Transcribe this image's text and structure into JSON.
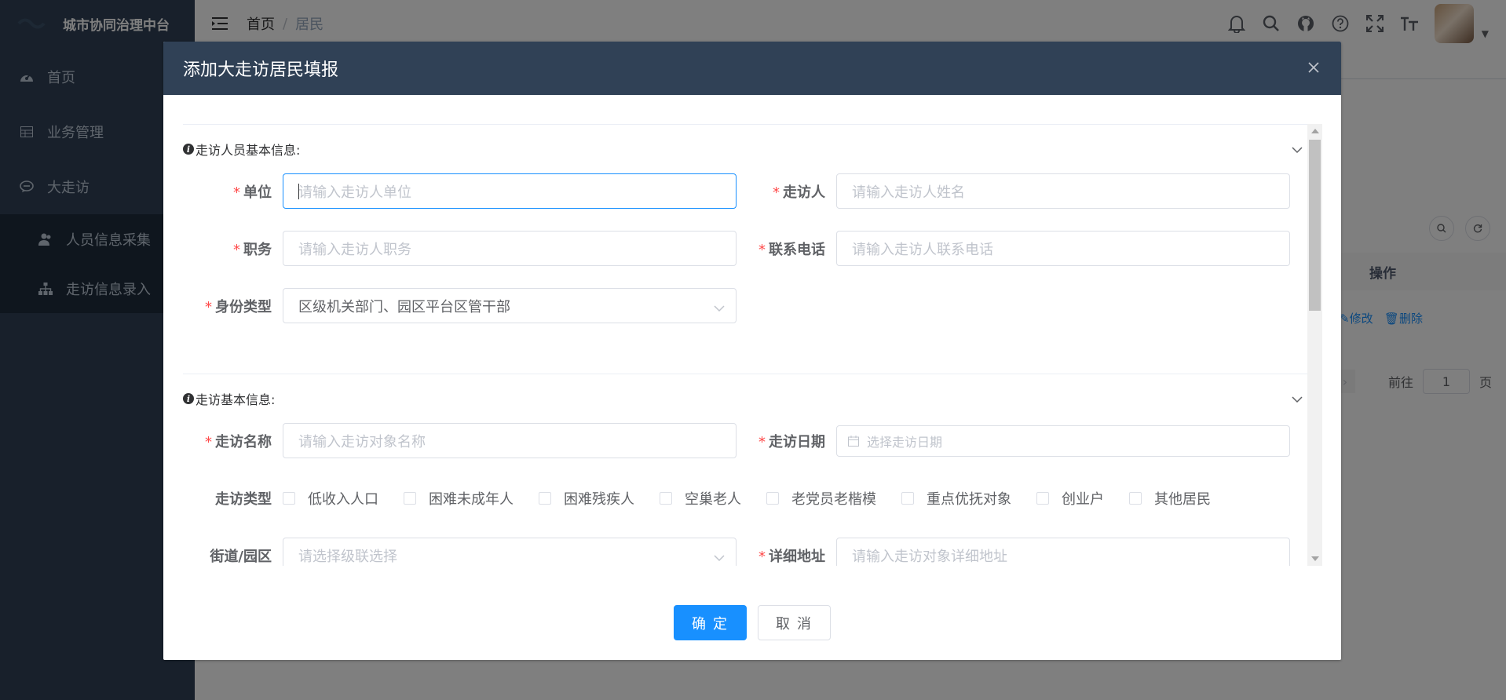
{
  "app": {
    "title": "城市协同治理中台"
  },
  "sidebar": {
    "items": [
      {
        "label": "首页",
        "icon": "dashboard-icon"
      },
      {
        "label": "业务管理",
        "icon": "table-icon"
      },
      {
        "label": "大走访",
        "icon": "chat-icon"
      }
    ],
    "submenu": [
      {
        "label": "人员信息采集",
        "icon": "people-icon"
      },
      {
        "label": "走访信息录入",
        "icon": "tree-icon"
      }
    ]
  },
  "breadcrumb": {
    "home": "首页",
    "separator": "/",
    "current": "居民"
  },
  "background": {
    "table_header": "操作",
    "edit_action": "修改",
    "delete_action": "删除",
    "pager_goto": "前往",
    "pager_page_value": "1",
    "pager_page_unit": "页"
  },
  "dialog": {
    "title": "添加大走访居民填报",
    "section1": {
      "title": "走访人员基本信息:",
      "unit_label": "单位",
      "unit_placeholder": "请输入走访人单位",
      "visitor_label": "走访人",
      "visitor_placeholder": "请输入走访人姓名",
      "position_label": "职务",
      "position_placeholder": "请输入走访人职务",
      "phone_label": "联系电话",
      "phone_placeholder": "请输入走访人联系电话",
      "identity_label": "身份类型",
      "identity_value": "区级机关部门、园区平台区管干部"
    },
    "section2": {
      "title": "走访基本信息:",
      "name_label": "走访名称",
      "name_placeholder": "请输入走访对象名称",
      "date_label": "走访日期",
      "date_placeholder": "选择走访日期",
      "type_label": "走访类型",
      "type_options": [
        "低收入人口",
        "困难未成年人",
        "困难残疾人",
        "空巢老人",
        "老党员老楷模",
        "重点优抚对象",
        "创业户",
        "其他居民"
      ],
      "street_label": "街道/园区",
      "street_placeholder": "请选择级联选择",
      "address_label": "详细地址",
      "address_placeholder": "请输入走访对象详细地址"
    },
    "confirm_label": "确 定",
    "cancel_label": "取 消"
  },
  "colors": {
    "primary": "#1890ff",
    "sidebar_bg": "#304156",
    "required": "#ff4949"
  }
}
